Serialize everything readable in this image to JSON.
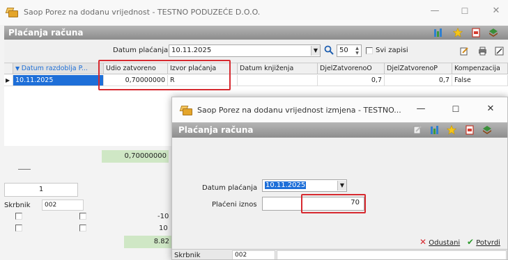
{
  "main": {
    "title": "Saop Porez na dodanu vrijednost - TESTNO PODUZEĆE D.O.O.",
    "header": "Plaćanja računa",
    "filter": {
      "date_label": "Datum plaćanja",
      "date_value": "10.11.2025",
      "count_value": "50",
      "all_records_label": "Svi zapisi"
    },
    "grid": {
      "columns": [
        "Datum razdoblja P...",
        "Udio zatvoreno",
        "Izvor plaćanja",
        "Datum knjiženja",
        "DjelZatvorenoO",
        "DjelZatvorenoP",
        "Kompenzacija"
      ],
      "row": {
        "date": "10.11.2025",
        "share": "0,70000000",
        "source": "R",
        "posting_date": "",
        "closed_o": "0,7",
        "closed_p": "0,7",
        "compensation": "False"
      }
    },
    "sum_value": "0,70000000",
    "page_number": "1",
    "lower": {
      "label": "Skrbnik",
      "code": "002",
      "cell_a": "-10",
      "cell_b": "10",
      "cell_c": "8.82"
    }
  },
  "dialog": {
    "title": "Saop Porez na dodanu vrijednost izmjena  - TESTNO...",
    "header": "Plaćanja računa",
    "date_label": "Datum plaćanja",
    "date_value": "10.11.2025",
    "amount_label": "Plaćeni iznos",
    "amount_value": "70",
    "cancel_label": "Odustani",
    "confirm_label": "Potvrdi",
    "status_label": "Skrbnik",
    "status_code": "002"
  },
  "colors": {
    "header_gray": "#9a9a9a",
    "selection_blue": "#1e6fd8",
    "highlight_red": "#d7292f",
    "sum_green": "#cfe7c5"
  },
  "icons": [
    "app-folder-icon",
    "minimize-icon",
    "maximize-icon",
    "close-icon",
    "columns-icon",
    "star-icon",
    "pdf-icon",
    "book-icon",
    "search-icon",
    "dropdown-icon",
    "spin-icon",
    "edit-icon",
    "print-icon",
    "export-icon",
    "cancel-x-icon",
    "confirm-check-icon"
  ]
}
